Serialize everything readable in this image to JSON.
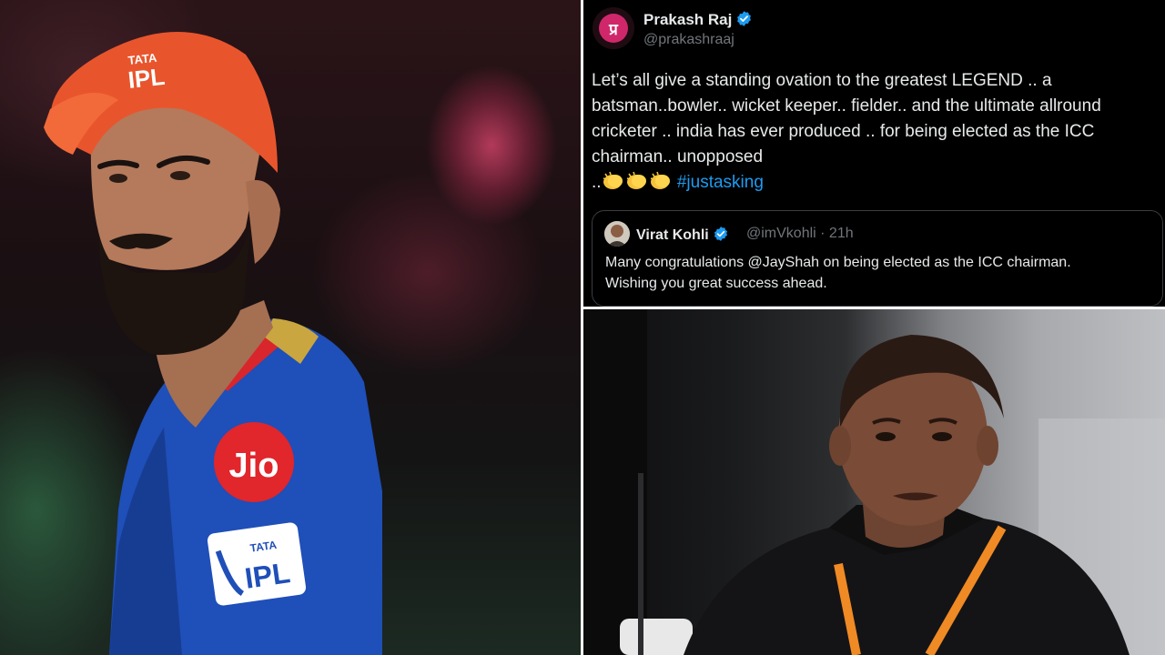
{
  "left_photo": {
    "cap_logo": "IPL",
    "cap_logo_small": "TATA",
    "jersey_sponsor": "Jio",
    "jersey_patch": "IPL",
    "jersey_patch_small": "TATA"
  },
  "tweet": {
    "author": {
      "name": "Prakash Raj",
      "handle": "@prakashraaj",
      "avatar_glyph": "प्र",
      "verified": true
    },
    "text_lines": [
      "Let’s all give a standing ovation to the greatest LEGEND .. a",
      "batsman..bowler.. wicket keeper.. fielder.. and the ultimate allround",
      "cricketer .. india has ever produced .. for being elected as the ICC",
      "chairman.. unopposed"
    ],
    "last_line_prefix": "..",
    "emoji": "clapping-hands",
    "hashtag": "#justasking",
    "quoted": {
      "name": "Virat Kohli",
      "handle": "@imVkohli · 21h",
      "verified": true,
      "text_lines": [
        "Many congratulations @JayShah on being elected as the ICC chairman.",
        "Wishing you great success ahead."
      ]
    }
  },
  "colors": {
    "link": "#1d9bf0",
    "verified": "#1d9bf0",
    "secondary_text": "#71767b",
    "primary_text": "#e7e9ea",
    "cap_orange": "#e8552d",
    "jersey_blue": "#1f4fb8",
    "lanyard_orange": "#f08a24"
  }
}
